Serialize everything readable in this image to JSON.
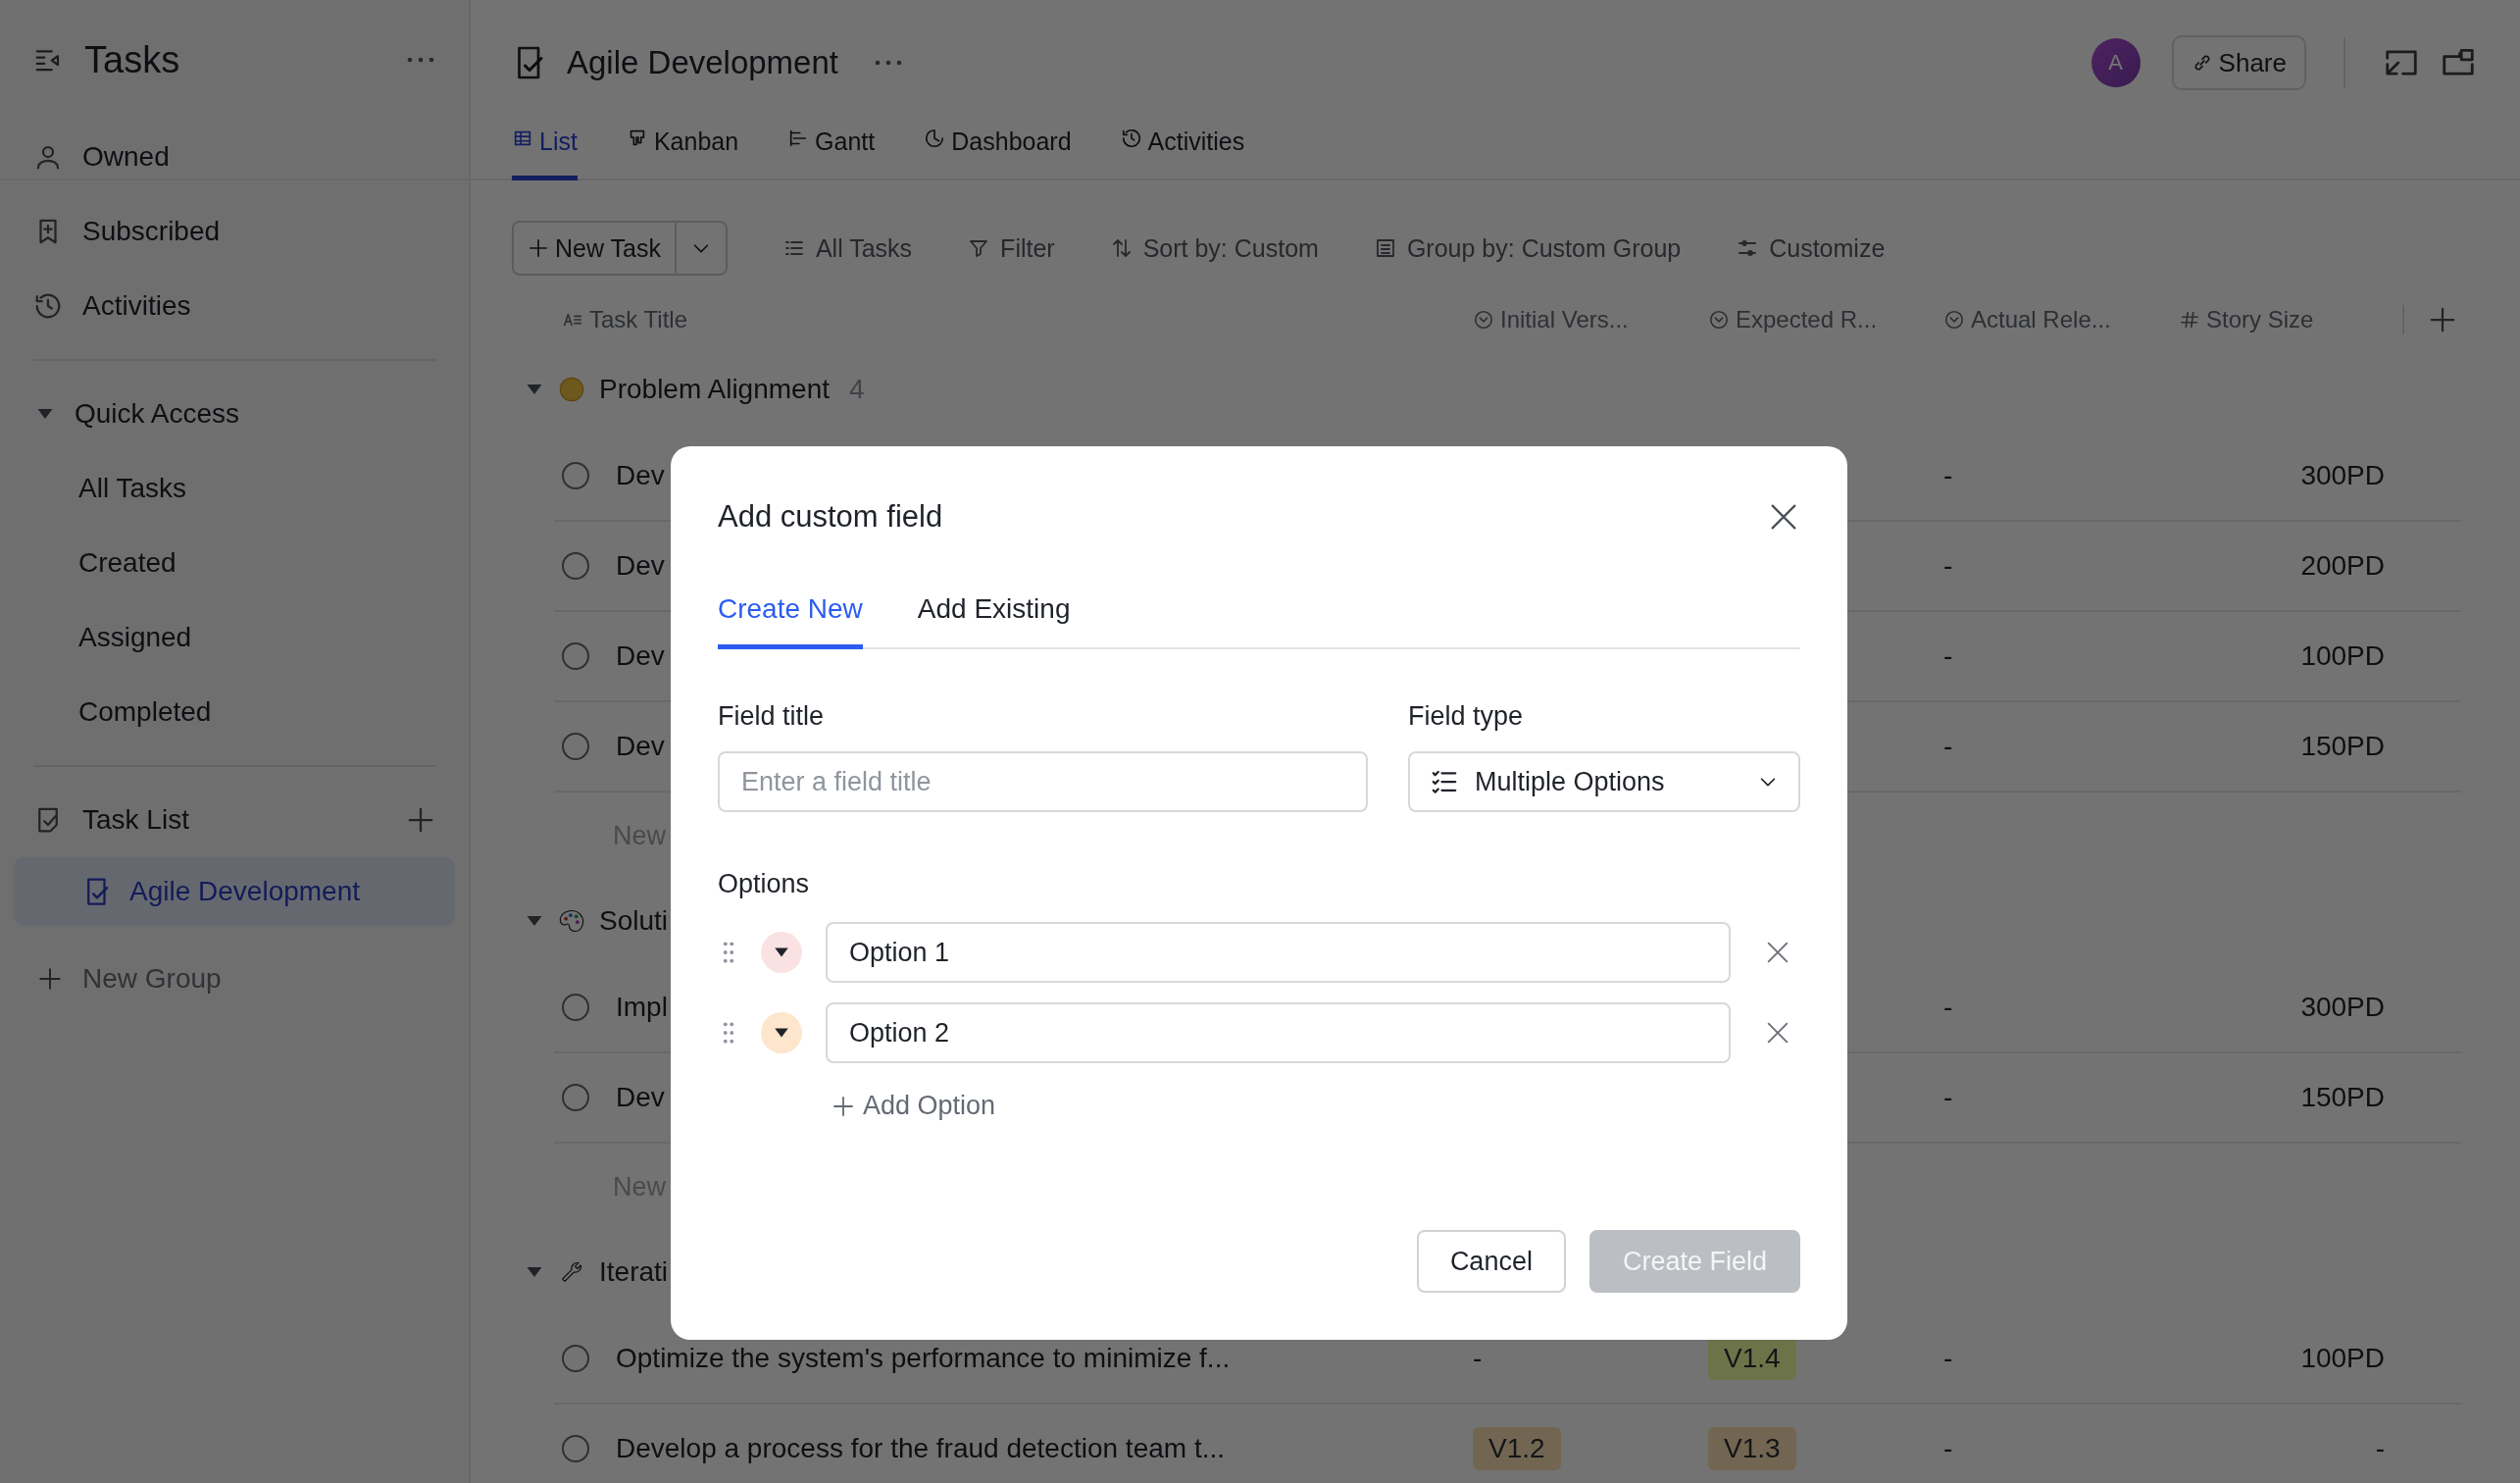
{
  "sidebar": {
    "title": "Tasks",
    "nav": [
      {
        "label": "Owned"
      },
      {
        "label": "Subscribed"
      },
      {
        "label": "Activities"
      }
    ],
    "quick_access": {
      "label": "Quick Access",
      "expanded": true,
      "items": [
        {
          "label": "All Tasks"
        },
        {
          "label": "Created"
        },
        {
          "label": "Assigned"
        },
        {
          "label": "Completed"
        }
      ]
    },
    "task_list": {
      "label": "Task List",
      "items": [
        {
          "label": "Agile Development",
          "selected": true
        }
      ]
    },
    "new_group": "New Group"
  },
  "header": {
    "title": "Agile Development",
    "avatar": "A",
    "share": "Share"
  },
  "tabs": [
    {
      "label": "List",
      "selected": true
    },
    {
      "label": "Kanban",
      "selected": false
    },
    {
      "label": "Gantt",
      "selected": false
    },
    {
      "label": "Dashboard",
      "selected": false
    },
    {
      "label": "Activities",
      "selected": false
    }
  ],
  "toolbar": {
    "new_task": "New Task",
    "actions": [
      {
        "label": "All Tasks"
      },
      {
        "label": "Filter"
      },
      {
        "label": "Sort by: Custom"
      },
      {
        "label": "Group by: Custom Group"
      },
      {
        "label": "Customize"
      }
    ]
  },
  "columns": [
    {
      "label": "Task Title"
    },
    {
      "label": "Initial Vers..."
    },
    {
      "label": "Expected R..."
    },
    {
      "label": "Actual Rele..."
    },
    {
      "label": "Story Size"
    }
  ],
  "groups": [
    {
      "name": "Problem Alignment",
      "count": "4",
      "expanded": true,
      "new_row": "New",
      "rows": [
        {
          "title": "Dev",
          "checked": false,
          "actual": "-",
          "story_size": "300PD"
        },
        {
          "title": "Dev",
          "checked": false,
          "actual": "-",
          "story_size": "200PD"
        },
        {
          "title": "Dev",
          "checked": false,
          "actual": "-",
          "story_size": "100PD"
        },
        {
          "title": "Dev",
          "checked": false,
          "actual": "-",
          "story_size": "150PD"
        }
      ]
    },
    {
      "name": "Soluti",
      "expanded": true,
      "new_row": "New",
      "rows": [
        {
          "title": "Impl",
          "checked": false,
          "actual": "-",
          "story_size": "300PD"
        },
        {
          "title": "Dev",
          "checked": false,
          "actual": "-",
          "story_size": "150PD"
        }
      ]
    },
    {
      "name": "Iterati",
      "expanded": true,
      "rows": [
        {
          "title": "Optimize the system's performance to minimize f...",
          "checked": false,
          "initial": {
            "text": "-"
          },
          "expected": {
            "text": "V1.4",
            "color": "#6d7349"
          },
          "actual": "-",
          "story_size": "100PD"
        },
        {
          "title": "Develop a process for the fraud detection team t...",
          "checked": false,
          "initial": {
            "text": "V1.2",
            "color": "#726652"
          },
          "expected": {
            "text": "V1.3",
            "color": "#726652"
          },
          "actual": "-",
          "story_size": "-"
        }
      ]
    }
  ],
  "modal": {
    "title": "Add custom field",
    "tabs": [
      {
        "label": "Create New",
        "selected": true
      },
      {
        "label": "Add Existing",
        "selected": false
      }
    ],
    "field_title": {
      "label": "Field title",
      "placeholder": "Enter a field title"
    },
    "field_type": {
      "label": "Field type",
      "value": "Multiple Options"
    },
    "options_label": "Options",
    "options": [
      {
        "value": "Option 1",
        "color": "#fbe2e2"
      },
      {
        "value": "Option 2",
        "color": "#fde6cc"
      }
    ],
    "add_option": "Add Option",
    "buttons": [
      {
        "label": "Cancel",
        "kind": "secondary",
        "disabled": false
      },
      {
        "label": "Create Field",
        "kind": "primary",
        "disabled": true
      }
    ]
  }
}
